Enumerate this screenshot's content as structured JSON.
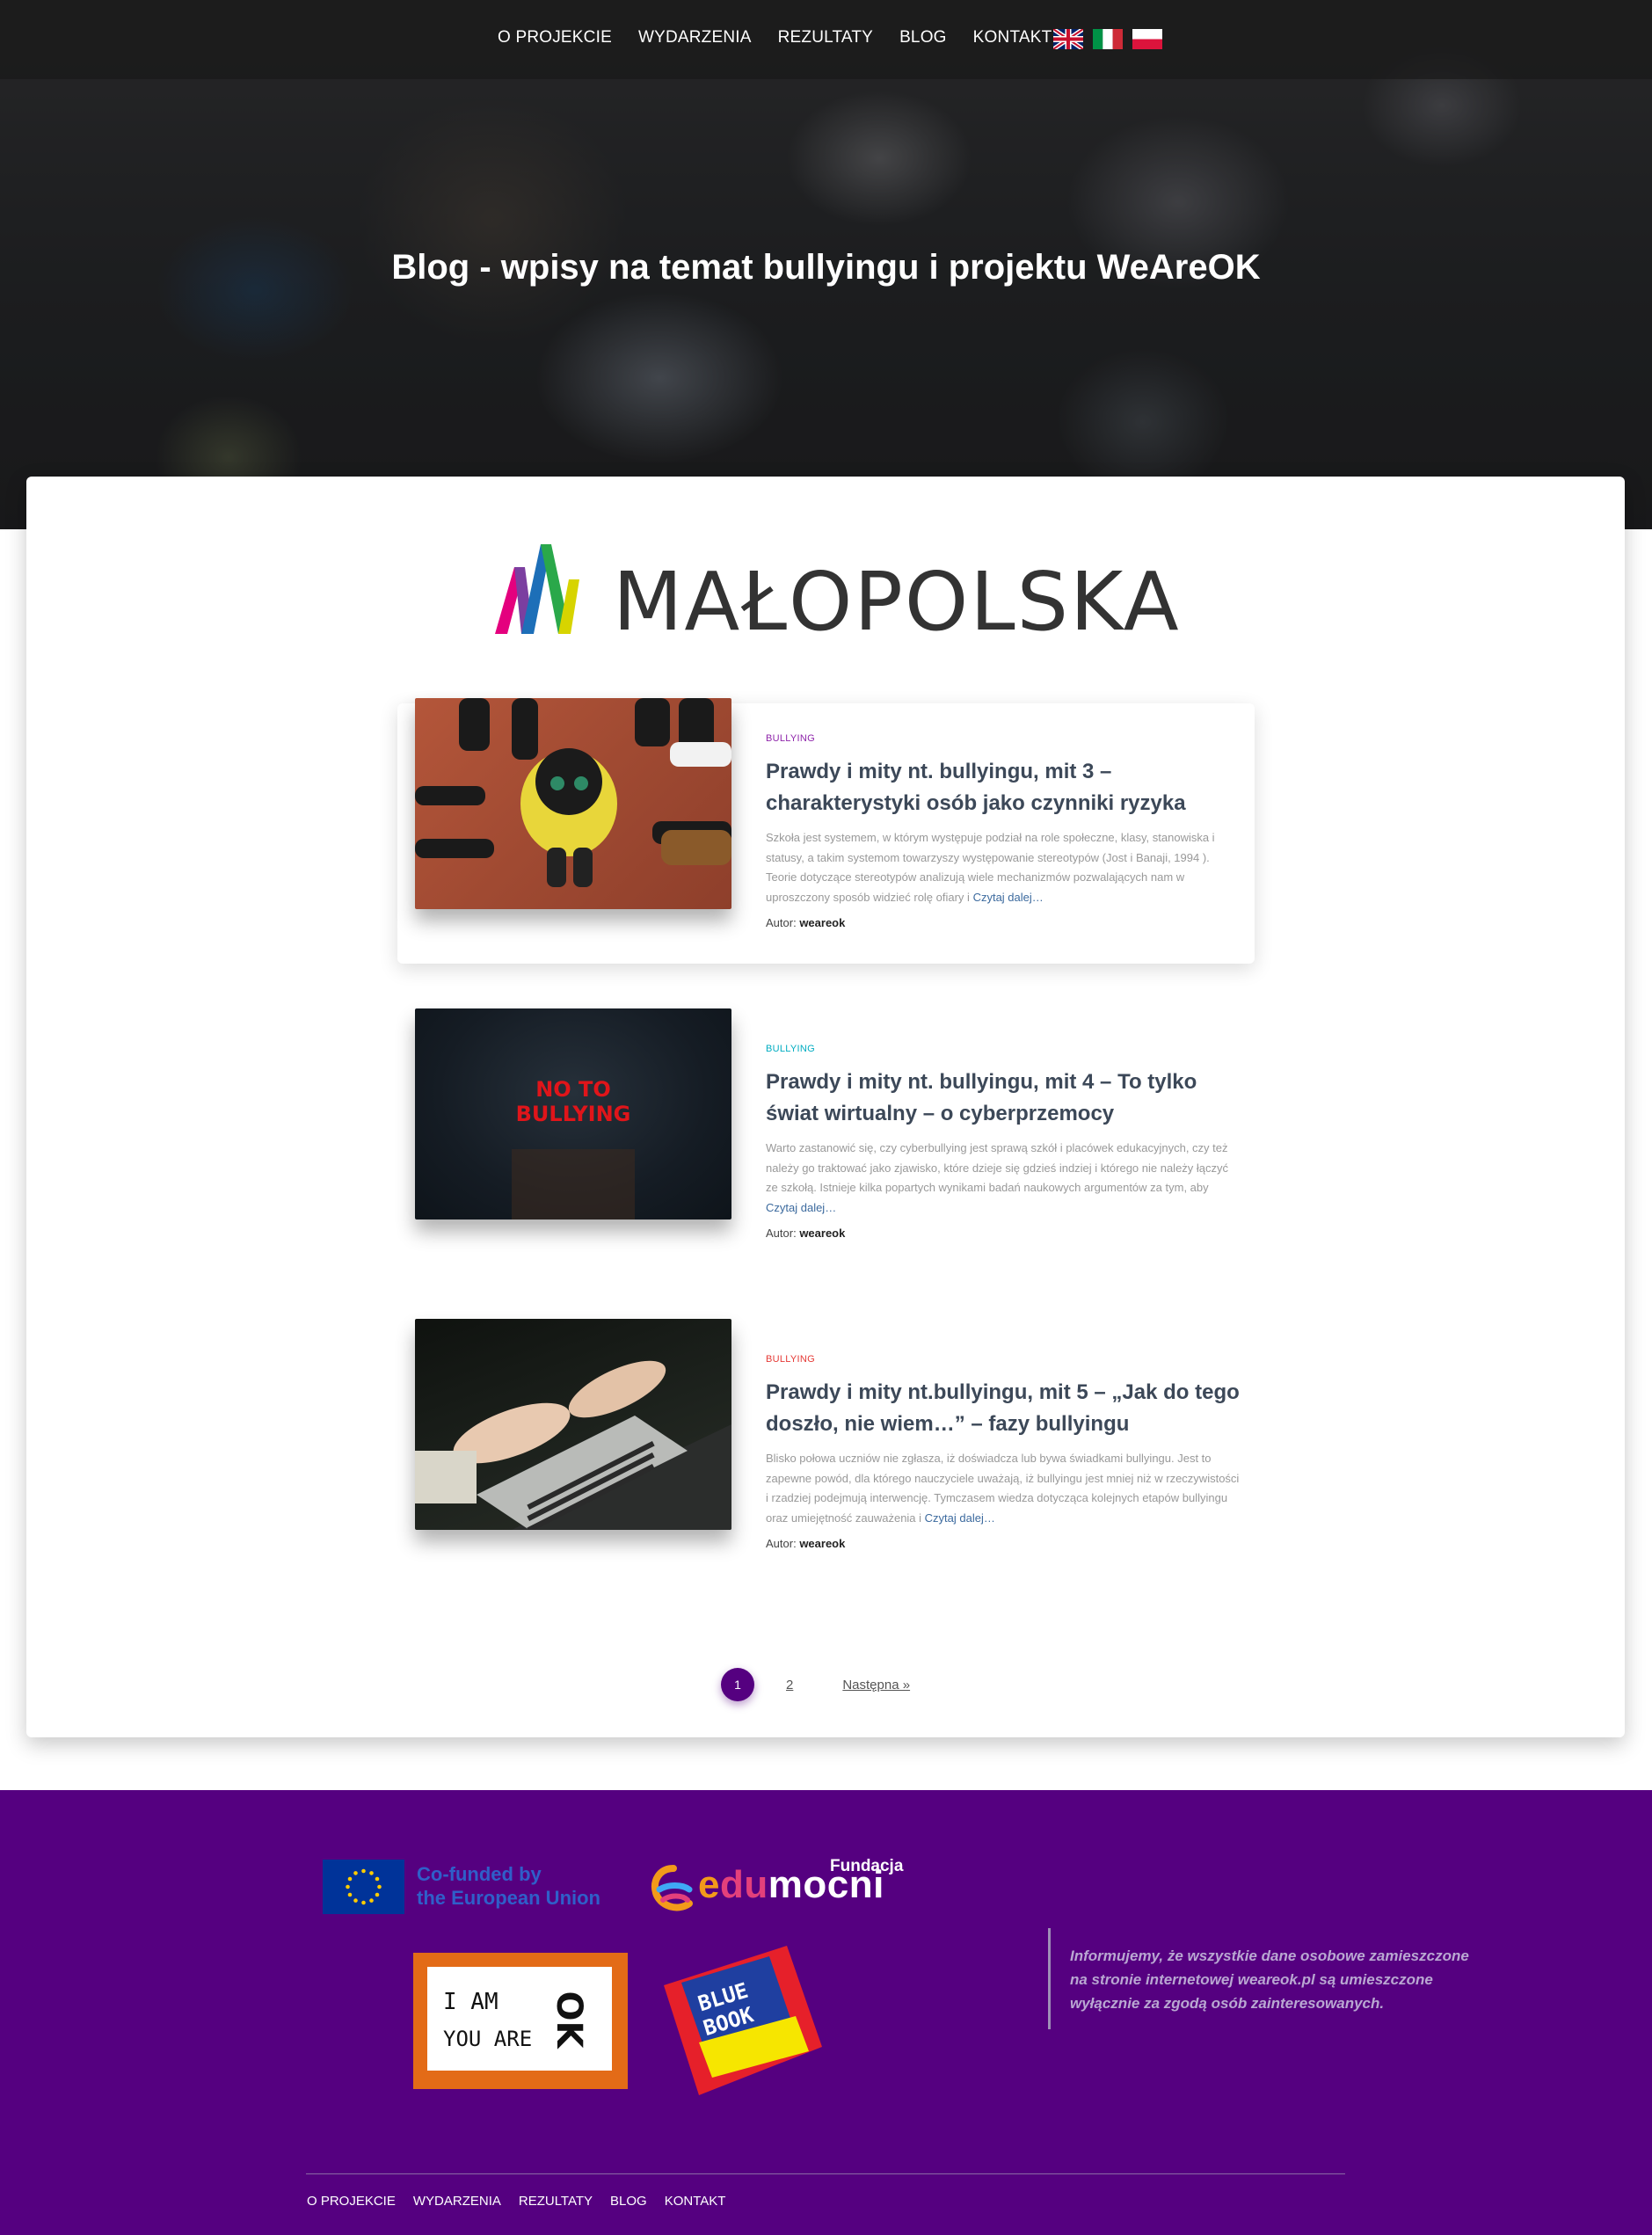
{
  "nav": {
    "items": [
      {
        "label": "O PROJEKCIE"
      },
      {
        "label": "WYDARZENIA"
      },
      {
        "label": "REZULTATY"
      },
      {
        "label": "BLOG"
      },
      {
        "label": "KONTAKT"
      }
    ],
    "flags": [
      {
        "name": "uk-flag-icon"
      },
      {
        "name": "italy-flag-icon"
      },
      {
        "name": "poland-flag-icon"
      }
    ]
  },
  "hero": {
    "title": "Blog - wpisy na temat bullyingu i projektu WeAreOK"
  },
  "sponsor_logo": {
    "text": "MAŁOPOLSKA"
  },
  "posts": [
    {
      "category": "BULLYING",
      "category_color": "#8e24aa",
      "title": "Prawdy i mity nt. bullyingu, mit 3 – charakterystyki osób jako czynniki ryzyka",
      "excerpt": "Szkoła jest systemem, w którym występuje podział na role społeczne, klasy, stanowiska i statusy, a takim systemom towarzyszy występowanie stereotypów (Jost i Banaji, 1994 ). Teorie dotyczące stereotypów analizują wiele mechanizmów pozwalających nam w uproszczony sposób widzieć rolę ofiary i",
      "read_more": "Czytaj dalej…",
      "author_label": "Autor:",
      "author": "weareok"
    },
    {
      "category": "BULLYING",
      "category_color": "#00acc1",
      "title": "Prawdy i mity nt. bullyingu, mit 4 – To tylko świat wirtualny – o cyberprzemocy",
      "excerpt": "Warto zastanowić się, czy cyberbullying jest sprawą szkół i placówek edukacyjnych, czy też należy go traktować jako zjawisko, które dzieje się gdzieś indziej i którego nie należy łączyć ze szkołą. Istnieje kilka popartych wynikami badań naukowych argumentów za tym, aby",
      "read_more": "Czytaj dalej…",
      "author_label": "Autor:",
      "author": "weareok",
      "image_text_1": "NO TO",
      "image_text_2": "BULLYING"
    },
    {
      "category": "BULLYING",
      "category_color": "#e53935",
      "title": "Prawdy i mity nt.bullyingu, mit 5 – „Jak do tego doszło, nie wiem…” – fazy bullyingu",
      "excerpt": "Blisko połowa uczniów nie zgłasza, iż doświadcza lub bywa świadkami bullyingu. Jest to zapewne powód, dla którego nauczyciele uważają, iż bullyingu jest mniej niż w rzeczywistości i rzadziej podejmują interwencję. Tymczasem wiedza dotycząca kolejnych etapów bullyingu oraz umiejętność zauważenia i",
      "read_more": "Czytaj dalej…",
      "author_label": "Autor:",
      "author": "weareok"
    }
  ],
  "pagination": {
    "current": "1",
    "next_page": "2",
    "next_label": "Następna »"
  },
  "footer": {
    "eu_text_line1": "Co-funded by",
    "eu_text_line2": "the European Union",
    "edu_small": "Fundacja",
    "edu_e": "e",
    "edu_du": "du",
    "edu_mocni": "mocni",
    "ok_line1": "I AM",
    "ok_line2": "YOU ARE",
    "ok_mark": "OK",
    "bluebook_line1": "BLUE",
    "bluebook_line2": "BOOK",
    "notice": "Informujemy, że wszystkie dane osobowe zamieszczone na stronie internetowej weareok.pl są umieszczone wyłącznie za zgodą osób zainteresowanych.",
    "nav": [
      {
        "label": "O PROJEKCIE"
      },
      {
        "label": "WYDARZENIA"
      },
      {
        "label": "REZULTATY"
      },
      {
        "label": "BLOG"
      },
      {
        "label": "KONTAKT"
      }
    ]
  },
  "colors": {
    "accent_purple": "#550080",
    "title_text": "#3c4858"
  }
}
